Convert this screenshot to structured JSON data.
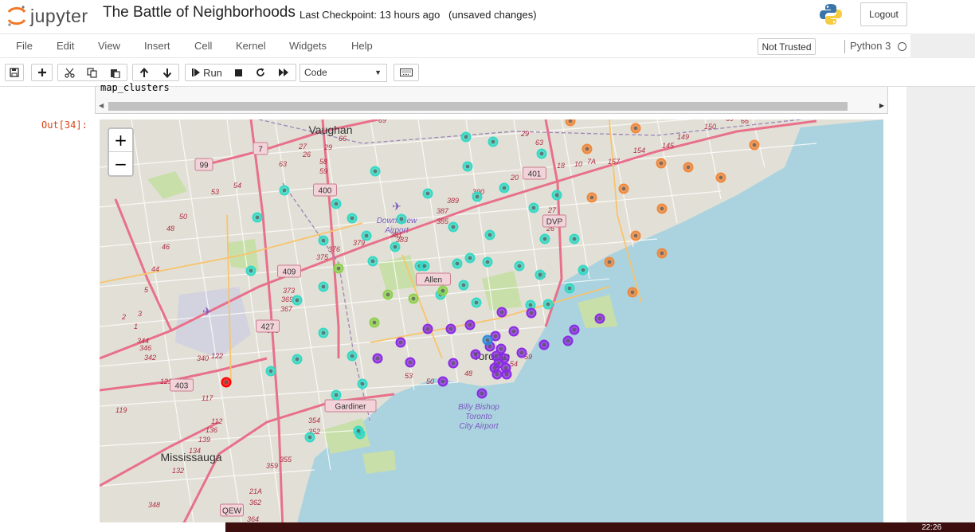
{
  "app": {
    "logo_text": "jupyter",
    "notebook_title": "The Battle of Neighborhoods",
    "checkpoint": "Last Checkpoint: 13 hours ago",
    "unsaved": "(unsaved changes)",
    "logout": "Logout"
  },
  "menu": {
    "items": [
      "File",
      "Edit",
      "View",
      "Insert",
      "Cell",
      "Kernel",
      "Widgets",
      "Help"
    ],
    "trust": "Not Trusted",
    "kernel": "Python 3"
  },
  "toolbar": {
    "run_label": "Run",
    "cell_type": "Code"
  },
  "cell": {
    "code": "map_clusters",
    "out_prompt": "Out[34]:"
  },
  "map": {
    "zoom_in": "+",
    "zoom_out": "−",
    "places": [
      "Vaughan",
      "Mississauga",
      "Toronto",
      "Downsview Airport",
      "Billy Bishop Toronto City Airport"
    ],
    "shields": [
      "7",
      "99",
      "400",
      "401",
      "DVP",
      "409",
      "427",
      "403",
      "Gardiner",
      "Allen",
      "QEW"
    ],
    "route_numbers": [
      "69",
      "66",
      "29",
      "63",
      "27",
      "26",
      "58",
      "59",
      "54",
      "53",
      "50",
      "48",
      "46",
      "44",
      "5",
      "3",
      "1",
      "2",
      "344",
      "346",
      "342",
      "340",
      "122",
      "121",
      "119",
      "117",
      "112",
      "136",
      "139",
      "134",
      "132",
      "348",
      "352",
      "354",
      "355",
      "359",
      "21A",
      "362",
      "364",
      "365",
      "367",
      "369",
      "373",
      "375",
      "376",
      "379",
      "381",
      "383",
      "385",
      "387",
      "389",
      "390",
      "20",
      "18",
      "10",
      "7A",
      "157",
      "154",
      "145",
      "149",
      "150"
    ],
    "clusters": {
      "colors": {
        "teal": "#33d9c5",
        "orange": "#f0883b",
        "purple": "#8a2be2",
        "green": "#8fd14f",
        "red": "#ff0000",
        "blue": "#2b8cd9"
      }
    }
  },
  "taskbar": {
    "clock": "22:26"
  }
}
